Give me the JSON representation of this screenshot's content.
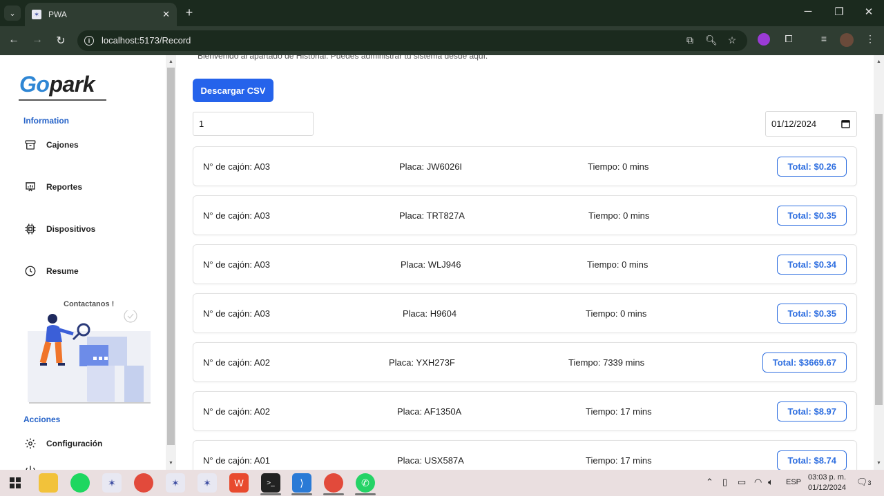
{
  "browser": {
    "tab_title": "PWA",
    "tab_close": "✕",
    "new_tab": "+",
    "url": "localhost:5173/Record",
    "window_controls": [
      "─",
      "❐",
      "✕"
    ]
  },
  "sidebar": {
    "logo_go": "Go",
    "logo_park": "park",
    "section_information": "Information",
    "items": [
      {
        "label": "Cajones",
        "icon": "archive-icon"
      },
      {
        "label": "Reportes",
        "icon": "presentation-chart-icon"
      },
      {
        "label": "Dispositivos",
        "icon": "chip-icon"
      },
      {
        "label": "Resume",
        "icon": "clock-icon"
      }
    ],
    "contact_label": "Contactanos !",
    "section_actions": "Acciones",
    "actions": [
      {
        "label": "Configuración",
        "icon": "gear-icon"
      }
    ]
  },
  "main": {
    "welcome_text": "Bienvenido al apartado de Historial. Puedes administrar tu sistema desde aquí.",
    "csv_button": "Descargar CSV",
    "number_input_value": "1",
    "date_value": "01/12/2024",
    "records": [
      {
        "cajon": "N° de cajón: A03",
        "placa": "Placa: JW6026I",
        "tiempo": "Tiempo: 0 mins",
        "total": "Total: $0.26"
      },
      {
        "cajon": "N° de cajón: A03",
        "placa": "Placa: TRT827A",
        "tiempo": "Tiempo: 0 mins",
        "total": "Total: $0.35"
      },
      {
        "cajon": "N° de cajón: A03",
        "placa": "Placa: WLJ946",
        "tiempo": "Tiempo: 0 mins",
        "total": "Total: $0.34"
      },
      {
        "cajon": "N° de cajón: A03",
        "placa": "Placa: H9604",
        "tiempo": "Tiempo: 0 mins",
        "total": "Total: $0.35"
      },
      {
        "cajon": "N° de cajón: A02",
        "placa": "Placa: YXH273F",
        "tiempo": "Tiempo: 7339 mins",
        "total": "Total: $3669.67"
      },
      {
        "cajon": "N° de cajón: A02",
        "placa": "Placa: AF1350A",
        "tiempo": "Tiempo: 17 mins",
        "total": "Total: $8.97"
      },
      {
        "cajon": "N° de cajón: A01",
        "placa": "Placa: USX587A",
        "tiempo": "Tiempo: 17 mins",
        "total": "Total: $8.74"
      }
    ]
  },
  "taskbar": {
    "language": "ESP",
    "time": "03:03 p. m.",
    "date": "01/12/2024",
    "notification_count": "3"
  },
  "colors": {
    "accent": "#2563eb",
    "logo_blue": "#2e86d4",
    "section_blue": "#2663c8",
    "browser_dark": "#1b2a1e"
  }
}
